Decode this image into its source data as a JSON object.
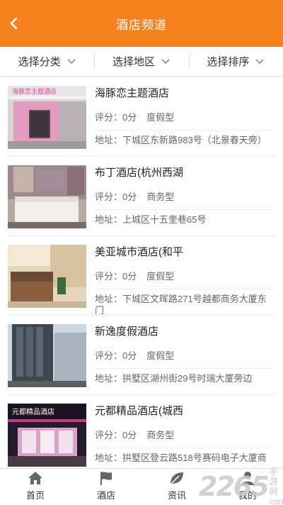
{
  "header": {
    "title": "酒店频道"
  },
  "filters": [
    {
      "label": "选择分类"
    },
    {
      "label": "选择地区"
    },
    {
      "label": "选择排序"
    }
  ],
  "hotels": [
    {
      "name": "海豚恋主题酒店",
      "rating": "评分：0分",
      "type": "度假型",
      "address": "地址：下城区东新路983号（北景春天旁）",
      "sign_text": "海豚恋主题酒店"
    },
    {
      "name": "布丁酒店(杭州西湖",
      "rating": "评分：0分",
      "type": "商务型",
      "address": "地址：上城区十五奎巷65号"
    },
    {
      "name": "美亚城市酒店(和平",
      "rating": "评分：0分",
      "type": "度假型",
      "address": "地址：下城区文晖路271号越都商务大厦东门"
    },
    {
      "name": "新逸度假酒店",
      "rating": "评分：0分",
      "type": "度假型",
      "address": "地址：拱墅区湖州街29号时瑞大厦旁边"
    },
    {
      "name": "元都精品酒店(城西",
      "rating": "评分：0分",
      "type": "商务型",
      "address": "地址：拱墅区登云路518号赛码电子大厦商",
      "sign_text": "元都精品酒店"
    }
  ],
  "tabs": [
    {
      "label": "首页",
      "icon": "home-icon"
    },
    {
      "label": "酒店",
      "icon": "flag-icon"
    },
    {
      "label": "资讯",
      "icon": "leaf-icon"
    },
    {
      "label": "我的",
      "icon": "user-icon"
    }
  ],
  "watermark": {
    "big": "2265",
    "small": "手游网",
    "small2": "com"
  },
  "colors": {
    "accent": "#f6821f",
    "text": "#333333",
    "muted": "#666666"
  }
}
